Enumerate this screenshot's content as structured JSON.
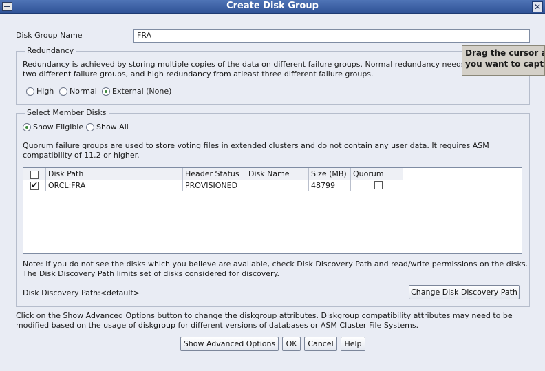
{
  "window": {
    "title": "Create Disk Group",
    "close_glyph": "✕"
  },
  "disk_group_name": {
    "label": "Disk Group Name",
    "value": "FRA"
  },
  "redundancy": {
    "legend": "Redundancy",
    "description_line1": "Redundancy is achieved by storing multiple copies of the data on different failure groups. Normal redundancy needs dis",
    "description_line2": "two different failure groups, and high redundancy from atleast three different failure groups.",
    "options": [
      {
        "label": "High",
        "selected": false
      },
      {
        "label": "Normal",
        "selected": false
      },
      {
        "label": "External (None)",
        "selected": true
      }
    ]
  },
  "member_disks": {
    "legend": "Select Member Disks",
    "filter_options": [
      {
        "label": "Show Eligible",
        "selected": true
      },
      {
        "label": "Show All",
        "selected": false
      }
    ],
    "quorum_note_line1": "Quorum failure groups are used to store voting files in extended clusters and do not contain any user data. It requires ASM",
    "quorum_note_line2": "compatibility of 11.2 or higher.",
    "table": {
      "columns": [
        "Disk Path",
        "Header Status",
        "Disk Name",
        "Size (MB)",
        "Quorum"
      ],
      "rows": [
        {
          "selected": true,
          "disk_path": "ORCL:FRA",
          "header_status": "PROVISIONED",
          "disk_name": "",
          "size_mb": "48799",
          "quorum": false
        }
      ]
    },
    "note_line1": "Note: If you do not see the disks which you believe are available, check Disk Discovery Path and read/write permissions on the disks.",
    "note_line2": "The Disk Discovery Path limits set of disks considered for discovery.",
    "discovery_path_label": "Disk Discovery Path:<default>",
    "change_path_button": "Change Disk Discovery Path"
  },
  "footer": {
    "info_line1": "Click on the Show Advanced Options button to change the diskgroup attributes. Diskgroup compatibility attributes may need to be",
    "info_line2": "modified based on the usage of diskgroup for different versions of databases or ASM Cluster File Systems.",
    "buttons": {
      "advanced": "Show Advanced Options",
      "ok": "OK",
      "cancel": "Cancel",
      "help": "Help"
    }
  },
  "tooltip": {
    "line1": "Drag the cursor ar",
    "line2": "you want to captur"
  }
}
